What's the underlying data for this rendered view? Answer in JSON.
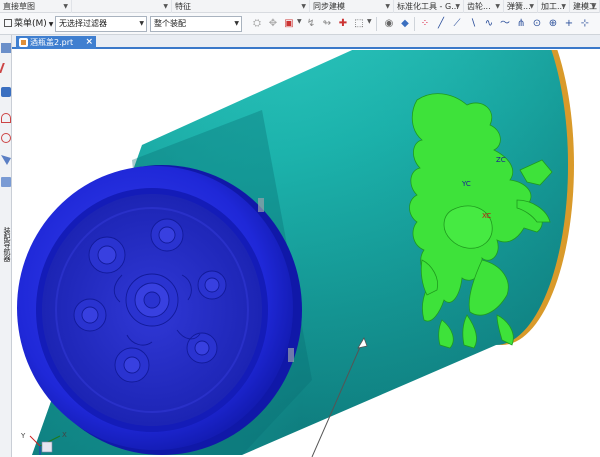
{
  "ribbon": {
    "groups": [
      {
        "label": "直接草图",
        "width": 72
      },
      {
        "label": "",
        "width": 100
      },
      {
        "label": "特征",
        "width": 138
      },
      {
        "label": "同步建模",
        "width": 84
      },
      {
        "label": "标准化工具 - G...",
        "width": 70
      },
      {
        "label": "齿轮...",
        "width": 40
      },
      {
        "label": "弹簧...",
        "width": 34
      },
      {
        "label": "加工...",
        "width": 32
      },
      {
        "label": "建模工",
        "width": 30
      }
    ]
  },
  "toolbar": {
    "menu_label": "菜单(M)",
    "filter_combo": "无选择过滤器",
    "assembly_combo": "整个装配"
  },
  "document": {
    "tab_label": "酒瓶盖2.prt",
    "close_glyph": "×"
  },
  "leftbar": {
    "vertical_text": "装配导航器"
  },
  "triad": {
    "axis_x": "X",
    "axis_y": "Y"
  },
  "model_labels": {
    "yc": "YC",
    "xc": "XC",
    "zc": "ZC"
  },
  "colors": {
    "cylinder_body": "#1fb4ad",
    "cap_blue": "#1e28e0",
    "relief_green": "#3ee23a",
    "edge_orange": "#d99a2a",
    "tab_active": "#3f7fd0"
  }
}
